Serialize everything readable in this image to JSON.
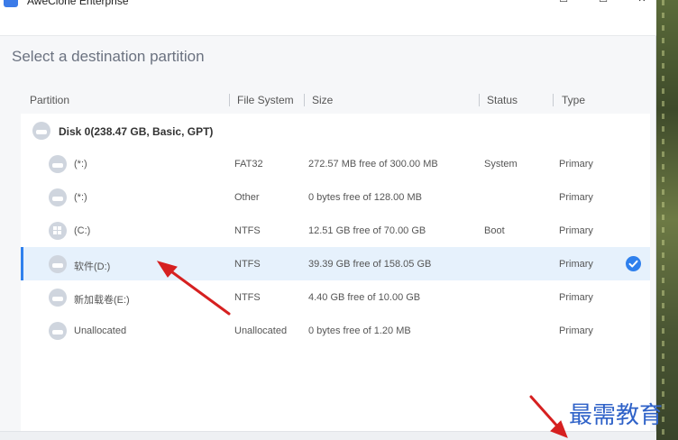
{
  "window": {
    "title": "AweClone Enterprise",
    "minimize": "—",
    "restore": "☐",
    "maximize": "☐",
    "close": "✕"
  },
  "heading": "Select a destination partition",
  "columns": {
    "partition": "Partition",
    "file_system": "File System",
    "size": "Size",
    "status": "Status",
    "type": "Type"
  },
  "disk": {
    "label": "Disk 0(238.47 GB, Basic, GPT)",
    "icon": "disk-icon"
  },
  "partitions": [
    {
      "name": "(*:)",
      "fs": "FAT32",
      "size": "272.57 MB free of 300.00 MB",
      "status": "System",
      "type": "Primary",
      "icon": "disk-icon",
      "selected": false
    },
    {
      "name": "(*:)",
      "fs": "Other",
      "size": "0 bytes free of 128.00 MB",
      "status": "",
      "type": "Primary",
      "icon": "disk-icon",
      "selected": false
    },
    {
      "name": "(C:)",
      "fs": "NTFS",
      "size": "12.51 GB free of 70.00 GB",
      "status": "Boot",
      "type": "Primary",
      "icon": "windows-icon",
      "selected": false
    },
    {
      "name": "软件(D:)",
      "fs": "NTFS",
      "size": "39.39 GB free of 158.05 GB",
      "status": "",
      "type": "Primary",
      "icon": "disk-icon",
      "selected": true
    },
    {
      "name": "新加载卷(E:)",
      "fs": "NTFS",
      "size": "4.40 GB free of 10.00 GB",
      "status": "",
      "type": "Primary",
      "icon": "disk-icon",
      "selected": false
    },
    {
      "name": "Unallocated",
      "fs": "Unallocated",
      "size": "0 bytes free of 1.20 MB",
      "status": "",
      "type": "Primary",
      "icon": "disk-icon",
      "selected": false
    }
  ],
  "selected_indicator": "checkmark-icon",
  "watermark": "最需教育",
  "colors": {
    "accent": "#2f80ed",
    "selected_row": "#e6f1fc",
    "annotation_arrow": "#d62020",
    "watermark": "#2f62c8"
  }
}
